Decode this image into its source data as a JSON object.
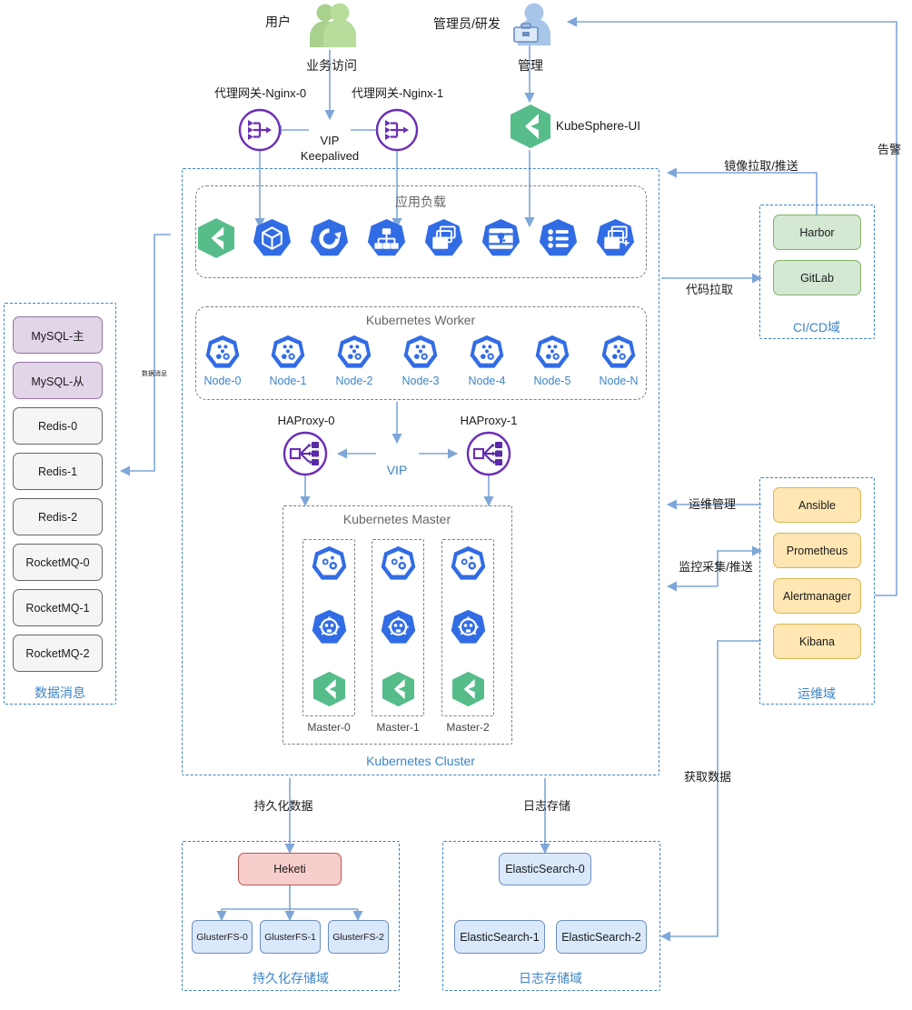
{
  "actors": {
    "user_label": "用户",
    "admin_label": "管理员/研发",
    "user_flow_label": "业务访问",
    "admin_flow_label": "管理",
    "kubesphere_ui_label": "KubeSphere-UI"
  },
  "gateways": {
    "nginx0_label": "代理网关-Nginx-0",
    "nginx1_label": "代理网关-Nginx-1",
    "vip_label": "VIP",
    "keepalived_label": "Keepalived"
  },
  "cluster": {
    "title": "Kubernetes Cluster",
    "app_load": {
      "title": "应用负载",
      "icons": [
        "kubesphere-icon",
        "k8s-pod-icon",
        "k8s-deployment-icon",
        "k8s-service-icon",
        "k8s-replicaset-icon",
        "k8s-secret-icon",
        "k8s-configmap-icon",
        "k8s-daemonset-icon"
      ]
    },
    "worker": {
      "title": "Kubernetes Worker",
      "nodes": [
        "Node-0",
        "Node-1",
        "Node-2",
        "Node-3",
        "Node-4",
        "Node-5",
        "Node-N"
      ]
    },
    "haproxy": {
      "left_label": "HAProxy-0",
      "right_label": "HAProxy-1",
      "vip_label": "VIP"
    },
    "master": {
      "title": "Kubernetes Master",
      "nodes": [
        "Master-0",
        "Master-1",
        "Master-2"
      ],
      "stack_icons": [
        "k8s-control-plane-icon",
        "k8s-etcd-icon",
        "kubesphere-icon"
      ]
    }
  },
  "data_zone": {
    "title": "数据消息",
    "items": [
      {
        "label": "MySQL-主",
        "style": "purple"
      },
      {
        "label": "MySQL-从",
        "style": "purple"
      },
      {
        "label": "Redis-0",
        "style": "gray"
      },
      {
        "label": "Redis-1",
        "style": "gray"
      },
      {
        "label": "Redis-2",
        "style": "gray"
      },
      {
        "label": "RocketMQ-0",
        "style": "gray"
      },
      {
        "label": "RocketMQ-1",
        "style": "gray"
      },
      {
        "label": "RocketMQ-2",
        "style": "gray"
      }
    ]
  },
  "cicd_zone": {
    "title": "CI/CD域",
    "items": [
      {
        "label": "Harbor",
        "style": "green"
      },
      {
        "label": "GitLab",
        "style": "green"
      }
    ]
  },
  "ops_zone": {
    "title": "运维域",
    "items": [
      {
        "label": "Ansible",
        "style": "yellow"
      },
      {
        "label": "Prometheus",
        "style": "yellow"
      },
      {
        "label": "Alertmanager",
        "style": "yellow"
      },
      {
        "label": "Kibana",
        "style": "yellow"
      }
    ]
  },
  "storage_zone": {
    "title": "持久化存储域",
    "controller": {
      "label": "Heketi",
      "style": "red"
    },
    "items": [
      {
        "label": "GlusterFS-0",
        "style": "bluebox"
      },
      {
        "label": "GlusterFS-1",
        "style": "bluebox"
      },
      {
        "label": "GlusterFS-2",
        "style": "bluebox"
      }
    ]
  },
  "log_zone": {
    "title": "日志存储域",
    "items": [
      {
        "label": "ElasticSearch-0",
        "style": "bluebox"
      },
      {
        "label": "ElasticSearch-1",
        "style": "bluebox"
      },
      {
        "label": "ElasticSearch-2",
        "style": "bluebox"
      }
    ]
  },
  "edge_labels": {
    "image_pull_push": "镜像拉取/推送",
    "code_pull": "代码拉取",
    "ops_manage": "运维管理",
    "monitor_collect_push": "监控采集/推送",
    "alert": "告警",
    "fetch_data": "获取数据",
    "data_message": "数据消息",
    "persist_data": "持久化数据",
    "log_storage": "日志存储"
  },
  "colors": {
    "line": "#7ea6d9",
    "zone_border": "#3d85c8",
    "zone_text": "#3d85c8",
    "k8s_blue": "#326ce5",
    "kubesphere_green": "#55bc8a",
    "nginx_purple": "#6c2fb5",
    "group_border": "#808080"
  }
}
